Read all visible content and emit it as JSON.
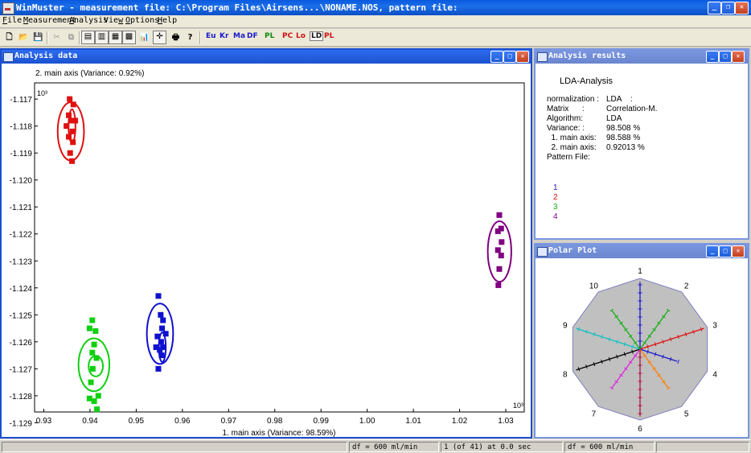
{
  "app": {
    "title": "WinMuster - measurement file: C:\\Program Files\\Airsens...\\NONAME.NOS, pattern file:"
  },
  "menu": [
    {
      "label": "File",
      "key": "F"
    },
    {
      "label": "Measurement",
      "key": "M"
    },
    {
      "label": "Analysis",
      "key": "A"
    },
    {
      "label": "View",
      "key": "w"
    },
    {
      "label": "Options",
      "key": "O"
    },
    {
      "label": "Help",
      "key": "H"
    }
  ],
  "toolbar": {
    "text_buttons": [
      "Eu",
      "Kr",
      "Ma",
      "DF",
      "PL",
      "PC",
      "Lo",
      "LD",
      "PL"
    ],
    "text_colors": [
      "#1a1acc",
      "#1a1acc",
      "#1a1acc",
      "#1a1acc",
      "#118811",
      "#cc1111",
      "#cc1111",
      "#111111",
      "#cc1111"
    ]
  },
  "windows": {
    "analysis_data_title": "Analysis data",
    "analysis_results_title": "Analysis results",
    "polar_plot_title": "Polar Plot"
  },
  "chart_data": {
    "type": "scatter",
    "title": "",
    "xlabel": "1. main axis (Variance: 98.59%)",
    "ylabel": "2. main axis (Variance: 0.92%)",
    "x_multiplier": "10³",
    "y_multiplier": "10³",
    "xlim": [
      0.928,
      1.034
    ],
    "ylim": [
      -1.1286,
      -1.1164
    ],
    "x_ticks": [
      0.93,
      0.94,
      0.95,
      0.96,
      0.97,
      0.98,
      0.99,
      1.0,
      1.01,
      1.02,
      1.03
    ],
    "x_tick_labels": [
      "0.93",
      "0.94",
      "0.95",
      "0.96",
      "0.97",
      "0.98",
      "0.99",
      "1.00",
      "1.01",
      "1.02",
      "1.03"
    ],
    "y_ticks": [
      -1.117,
      -1.118,
      -1.119,
      -1.12,
      -1.121,
      -1.122,
      -1.123,
      -1.124,
      -1.125,
      -1.126,
      -1.127,
      -1.128,
      -1.129
    ],
    "y_tick_labels": [
      "-1.117",
      "-1.118",
      "-1.119",
      "-1.120",
      "-1.121",
      "-1.122",
      "-1.123",
      "-1.124",
      "-1.125",
      "-1.126",
      "-1.127",
      "-1.128",
      "-1.129"
    ],
    "grid": false,
    "series": [
      {
        "color": "#e01010",
        "points": [
          [
            0.9356,
            -1.117
          ],
          [
            0.9364,
            -1.1172
          ],
          [
            0.9354,
            -1.1176
          ],
          [
            0.9359,
            -1.1178
          ],
          [
            0.9368,
            -1.1178
          ],
          [
            0.9349,
            -1.118
          ],
          [
            0.9362,
            -1.1182
          ],
          [
            0.9354,
            -1.1184
          ],
          [
            0.9363,
            -1.1186
          ],
          [
            0.9357,
            -1.119
          ],
          [
            0.9361,
            -1.1193
          ]
        ],
        "ellipses": [
          {
            "cx": 0.93585,
            "cy": -1.1182,
            "rx": 0.00285,
            "ry": 0.00108
          },
          {
            "cx": 0.9361,
            "cy": -1.118,
            "rx": 0.00075,
            "ry": 0.00062
          }
        ]
      },
      {
        "color": "#10d010",
        "points": [
          [
            0.9405,
            -1.1252
          ],
          [
            0.9399,
            -1.1255
          ],
          [
            0.9412,
            -1.1256
          ],
          [
            0.9409,
            -1.1261
          ],
          [
            0.9405,
            -1.1264
          ],
          [
            0.9414,
            -1.1266
          ],
          [
            0.9406,
            -1.127
          ],
          [
            0.9402,
            -1.1275
          ],
          [
            0.9418,
            -1.128
          ],
          [
            0.9399,
            -1.1281
          ],
          [
            0.9409,
            -1.1282
          ],
          [
            0.9415,
            -1.1285
          ]
        ],
        "ellipses": [
          {
            "cx": 0.94085,
            "cy": -1.12685,
            "rx": 0.00335,
            "ry": 0.00098
          },
          {
            "cx": 0.94125,
            "cy": -1.1269,
            "rx": 0.00155,
            "ry": 0.00038
          }
        ]
      },
      {
        "color": "#1010d0",
        "points": [
          [
            0.9548,
            -1.1243
          ],
          [
            0.9553,
            -1.125
          ],
          [
            0.9558,
            -1.1252
          ],
          [
            0.9556,
            -1.1255
          ],
          [
            0.9564,
            -1.1257
          ],
          [
            0.9546,
            -1.1258
          ],
          [
            0.9554,
            -1.126
          ],
          [
            0.9543,
            -1.1262
          ],
          [
            0.9558,
            -1.1262
          ],
          [
            0.9551,
            -1.1263
          ],
          [
            0.9555,
            -1.1265
          ],
          [
            0.9548,
            -1.127
          ]
        ],
        "ellipses": [
          {
            "cx": 0.95515,
            "cy": -1.1257,
            "rx": 0.00285,
            "ry": 0.00112
          },
          {
            "cx": 0.95565,
            "cy": -1.1262,
            "rx": 0.00075,
            "ry": 0.00055
          }
        ]
      },
      {
        "color": "#800080",
        "points": [
          [
            1.0286,
            -1.1213
          ],
          [
            1.029,
            -1.1218
          ],
          [
            1.0283,
            -1.1219
          ],
          [
            1.0291,
            -1.1223
          ],
          [
            1.0283,
            -1.1226
          ],
          [
            1.029,
            -1.1228
          ],
          [
            1.0286,
            -1.1233
          ],
          [
            1.0284,
            -1.1239
          ]
        ],
        "ellipses": [
          {
            "cx": 1.02865,
            "cy": -1.12265,
            "rx": 0.00255,
            "ry": 0.00112
          }
        ]
      }
    ]
  },
  "results": {
    "heading": "LDA-Analysis",
    "rows": [
      {
        "label": "normalization :",
        "value": "LDA    :"
      },
      {
        "label": "Matrix      :",
        "value": "Correlation-M."
      },
      {
        "label": "Algorithm:",
        "value": "LDA"
      },
      {
        "label": "Variance: :",
        "value": "98.508 %"
      },
      {
        "label": "  1. main axis:",
        "value": "98.588 %"
      },
      {
        "label": "  2. main axis:",
        "value": "0.92013 %"
      },
      {
        "label": "Pattern File:",
        "value": ""
      }
    ],
    "classes": [
      {
        "label": "1",
        "color": "#2020c0"
      },
      {
        "label": "2",
        "color": "#e01010"
      },
      {
        "label": "3",
        "color": "#10b010"
      },
      {
        "label": "4",
        "color": "#800080"
      }
    ]
  },
  "polar": {
    "axis_labels": [
      "1",
      "2",
      "3",
      "4",
      "5",
      "6",
      "7",
      "8",
      "9",
      "10"
    ],
    "axis_colors": [
      "#1a1acc",
      "#10b010",
      "#e01010",
      "#1a1acc",
      "#ff8000",
      "#b01040",
      "#e020e0",
      "#000000",
      "#10c0c0",
      "#10b010"
    ],
    "axis_lengths": [
      0.95,
      0.68,
      0.95,
      0.55,
      0.68,
      0.95,
      0.68,
      0.95,
      0.95,
      0.68
    ]
  },
  "status": {
    "cell1": "df = 600 ml/min",
    "cell2": "1 (of 41) at 0.0 sec",
    "cell3": "df = 600 ml/min"
  }
}
